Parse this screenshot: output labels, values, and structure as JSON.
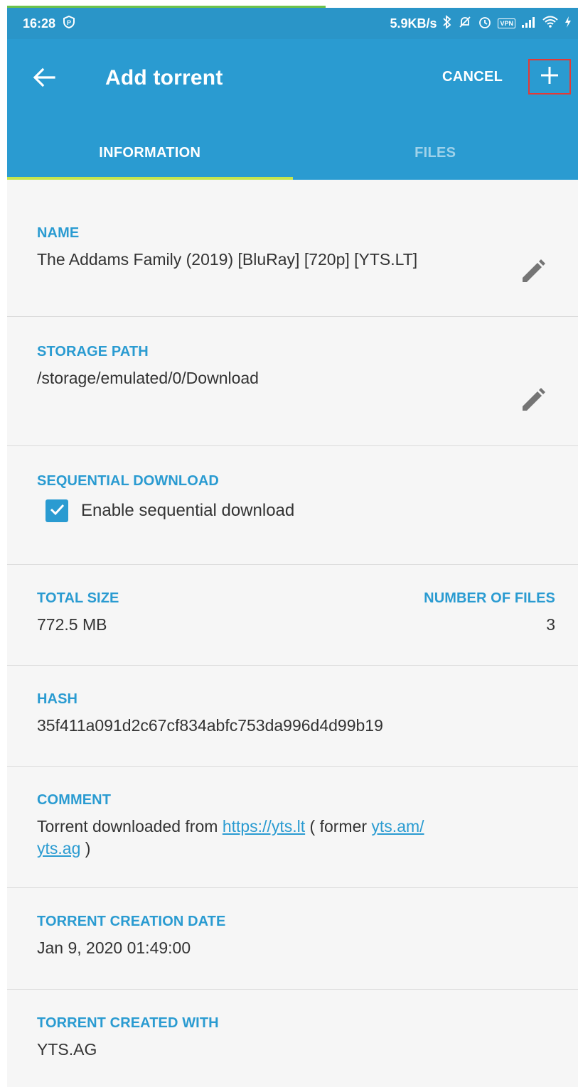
{
  "status_bar": {
    "time": "16:28",
    "net_speed": "5.9KB/s",
    "vpn": "VPN",
    "icons": [
      "p-badge-icon",
      "bluetooth-icon",
      "mute-icon",
      "alarm-icon",
      "vpn-icon",
      "signal-icon",
      "wifi-icon",
      "charging-icon"
    ]
  },
  "appbar": {
    "title": "Add torrent",
    "cancel_label": "CANCEL",
    "icons": [
      "back-arrow-icon",
      "plus-icon"
    ]
  },
  "tabs": [
    {
      "label": "INFORMATION",
      "active": true
    },
    {
      "label": "FILES",
      "active": false
    }
  ],
  "info": {
    "name": {
      "label": "NAME",
      "value": "The Addams Family (2019) [BluRay] [720p] [YTS.LT]"
    },
    "storage": {
      "label": "STORAGE PATH",
      "value": "/storage/emulated/0/Download"
    },
    "sequential": {
      "label": "SEQUENTIAL DOWNLOAD",
      "checkbox_label": "Enable sequential download",
      "checked": true
    },
    "total_size": {
      "label": "TOTAL SIZE",
      "value": "772.5 MB"
    },
    "num_files": {
      "label": "NUMBER OF FILES",
      "value": "3"
    },
    "hash": {
      "label": "HASH",
      "value": "35f411a091d2c67cf834abfc753da996d4d99b19"
    },
    "comment": {
      "label": "COMMENT",
      "text_before": "Torrent downloaded from ",
      "link1": "https://yts.lt",
      "text_middle": " ( former ",
      "link2_line1": "yts.am/",
      "link2_line2": "yts.ag",
      "text_after": " )"
    },
    "creation_date": {
      "label": "TORRENT CREATION DATE",
      "value": "Jan 9, 2020 01:49:00"
    },
    "created_with": {
      "label": "TORRENT CREATED WITH",
      "value": "YTS.AG"
    }
  },
  "colors": {
    "primary": "#2a9bd1",
    "status_bar": "#2a95c8",
    "tab_indicator": "#c6e54e",
    "highlight_box": "#e53935",
    "background": "#f6f6f6"
  }
}
